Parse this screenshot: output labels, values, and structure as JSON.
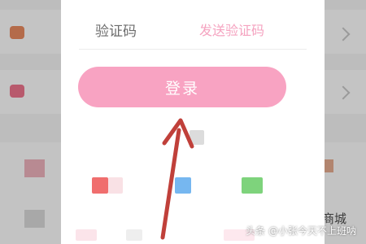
{
  "verification": {
    "label": "验证码",
    "send_button": "发送验证码"
  },
  "login": {
    "button_label": "登录"
  },
  "background": {
    "city_text": "商城"
  },
  "watermark": "头条 @小张今天不上班呐",
  "colors": {
    "accent_pink": "#f8a3c2",
    "send_link": "#f5a3c0",
    "arrow": "#c0403a"
  }
}
